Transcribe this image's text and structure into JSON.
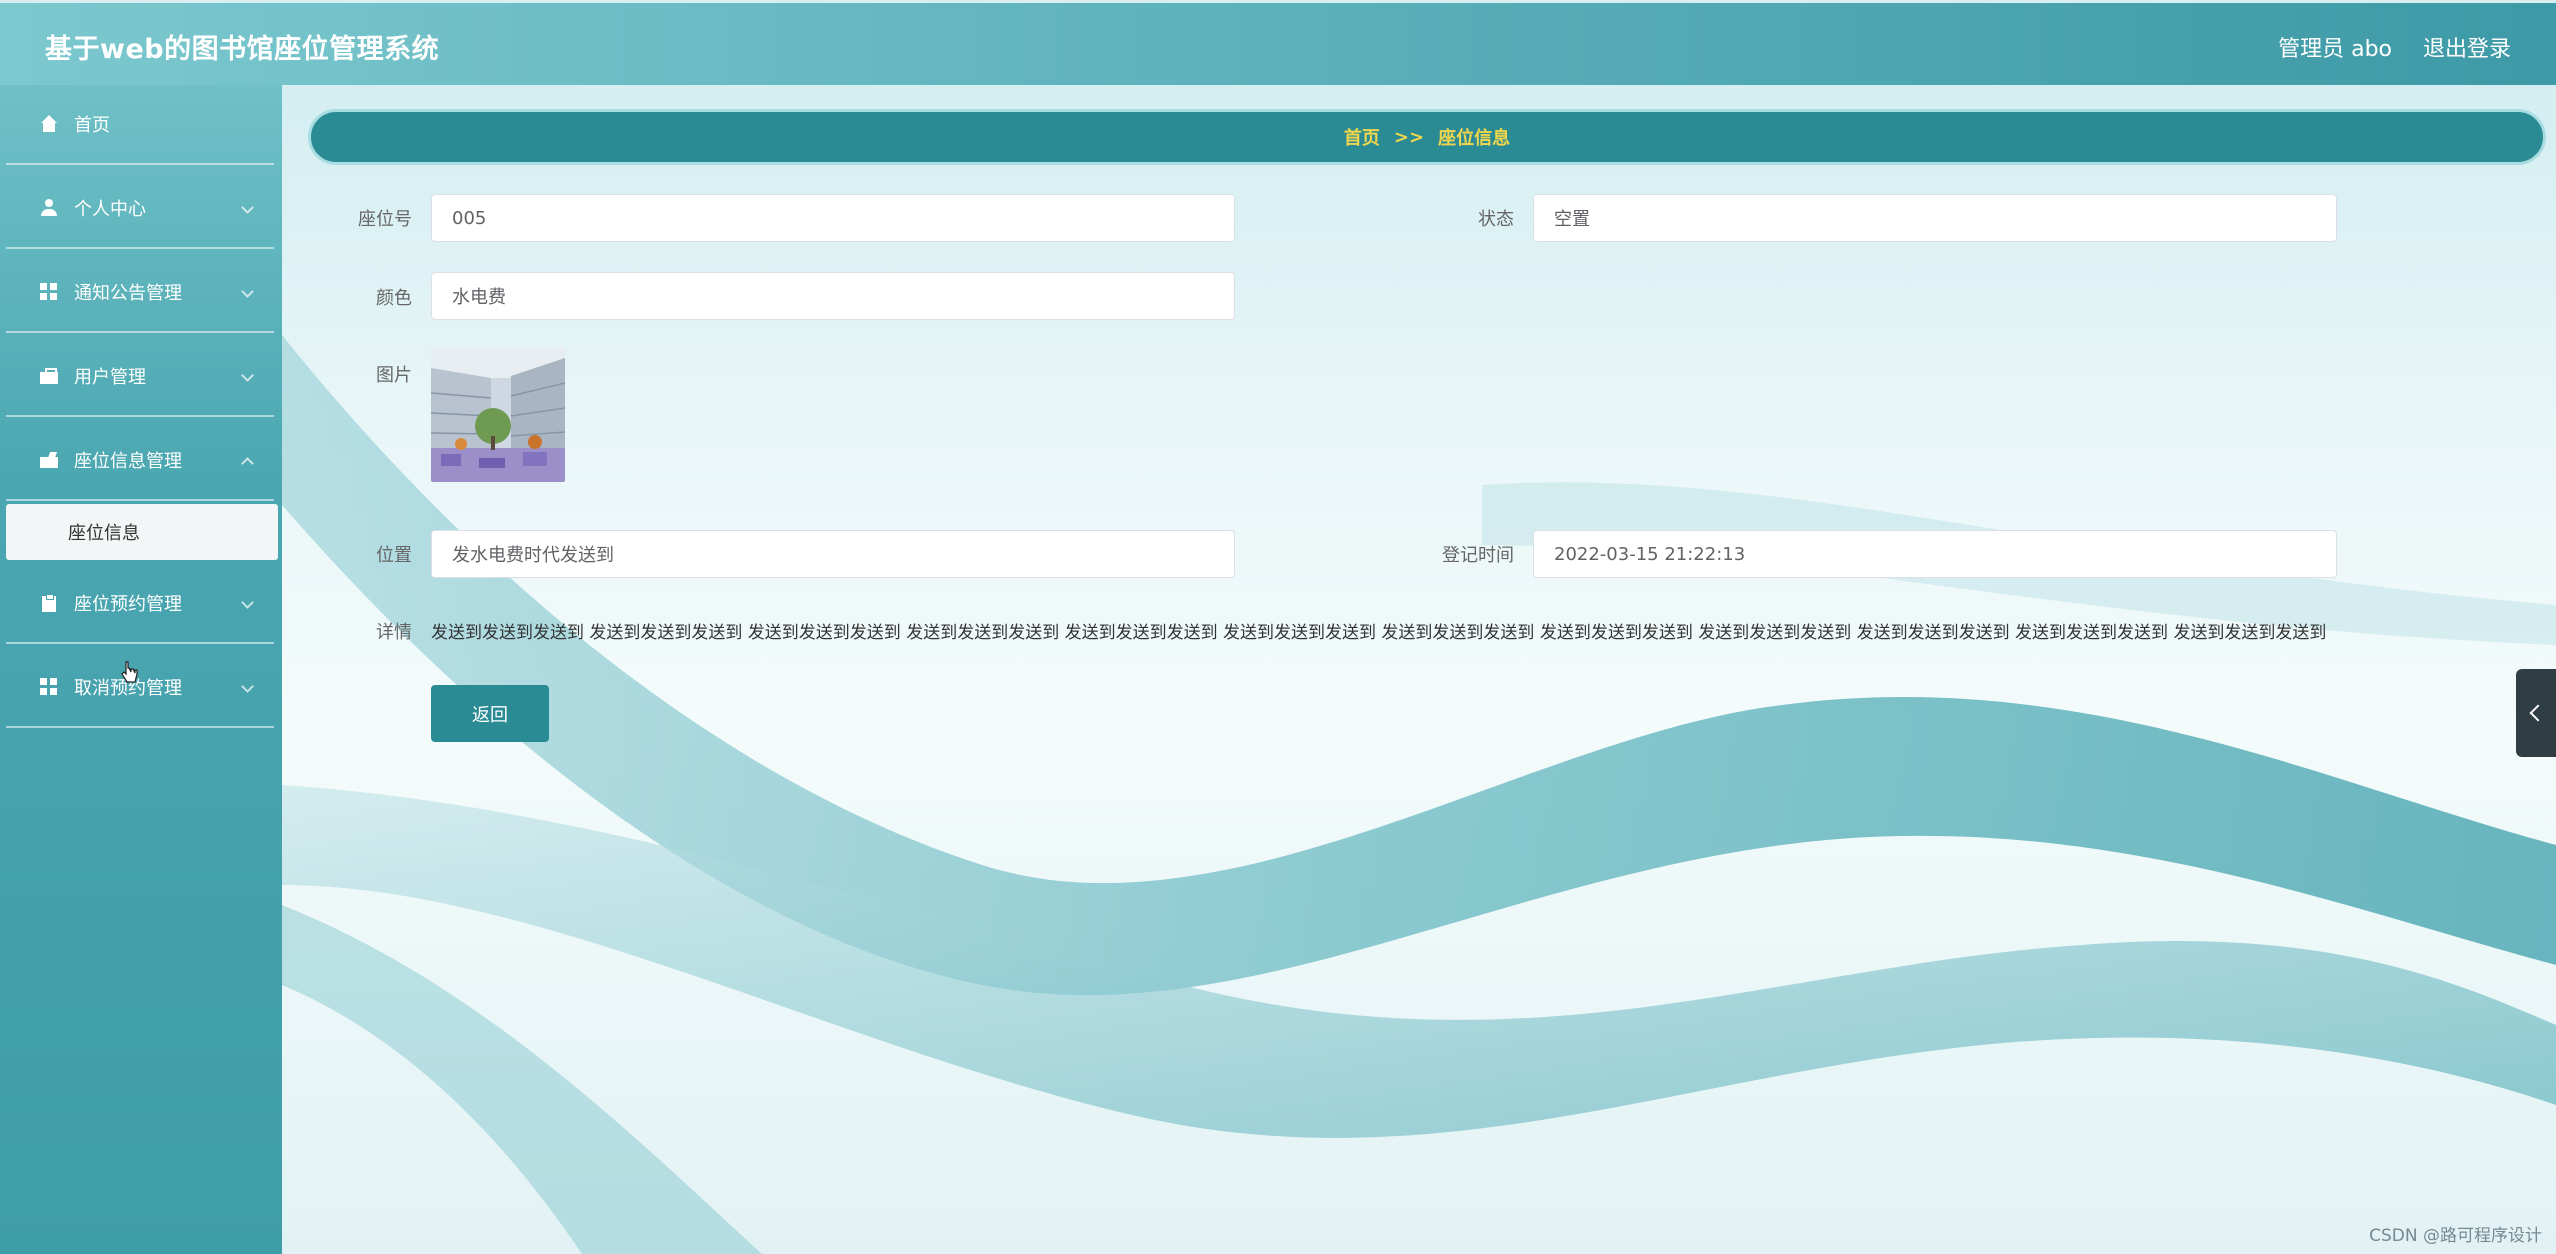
{
  "header": {
    "app_title": "基于web的图书馆座位管理系统",
    "user_label": "管理员 abo",
    "logout_label": "退出登录"
  },
  "sidebar": {
    "items": [
      {
        "label": "首页",
        "icon": "home-icon"
      },
      {
        "label": "个人中心",
        "icon": "user-icon"
      },
      {
        "label": "通知公告管理",
        "icon": "grid-icon"
      },
      {
        "label": "用户管理",
        "icon": "briefcase-icon"
      },
      {
        "label": "座位信息管理",
        "icon": "seat-icon"
      },
      {
        "label": "座位预约管理",
        "icon": "clipboard-icon"
      },
      {
        "label": "取消预约管理",
        "icon": "grid-icon"
      }
    ],
    "active_sub_item": "座位信息"
  },
  "breadcrumb": {
    "home": "首页",
    "separator": ">>",
    "current": "座位信息"
  },
  "form": {
    "seat_no_label": "座位号",
    "seat_no_value": "005",
    "status_label": "状态",
    "status_value": "空置",
    "color_label": "颜色",
    "color_value": "水电费",
    "image_label": "图片",
    "location_label": "位置",
    "location_value": "发水电费时代发送到",
    "reg_time_label": "登记时间",
    "reg_time_value": "2022-03-15 21:22:13",
    "details_label": "详情",
    "details_value": "发送到发送到发送到 发送到发送到发送到 发送到发送到发送到 发送到发送到发送到 发送到发送到发送到 发送到发送到发送到 发送到发送到发送到 发送到发送到发送到 发送到发送到发送到 发送到发送到发送到 发送到发送到发送到 发送到发送到发送到",
    "back_label": "返回"
  },
  "watermark": "CSDN @路可程序设计",
  "colors": {
    "accent": "#2a8b94",
    "breadcrumb_text": "#f0d64c"
  }
}
